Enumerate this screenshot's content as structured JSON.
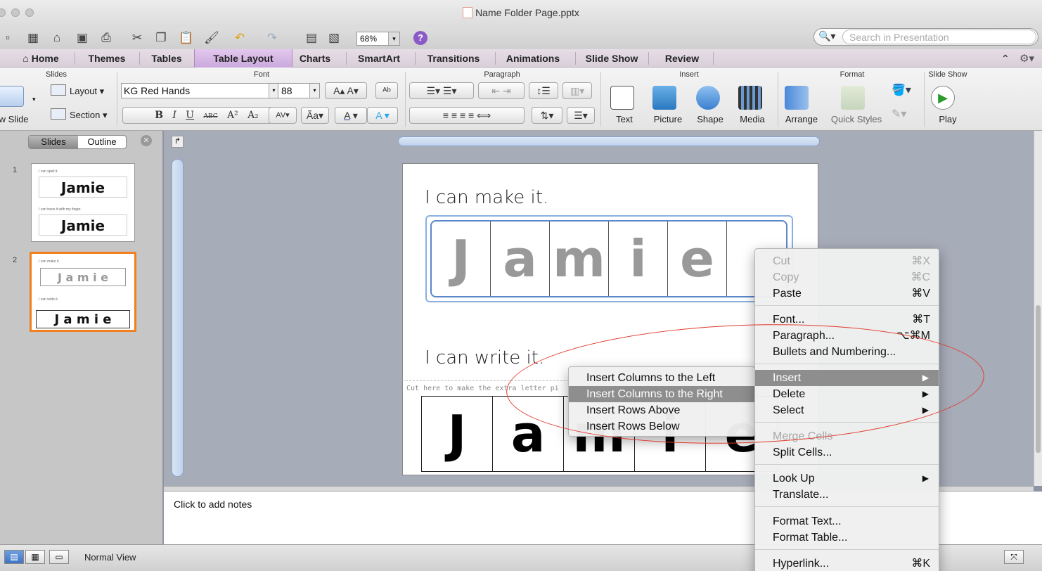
{
  "window": {
    "title": "Name Folder Page.pptx"
  },
  "toolbar": {
    "zoom": "68%",
    "search_placeholder": "Search in Presentation"
  },
  "tabs": [
    "Home",
    "Themes",
    "Tables",
    "Table Layout",
    "Charts",
    "SmartArt",
    "Transitions",
    "Animations",
    "Slide Show",
    "Review"
  ],
  "ribbon": {
    "groups": {
      "slides": "Slides",
      "font": "Font",
      "paragraph": "Paragraph",
      "insert": "Insert",
      "format": "Format",
      "slideshow": "Slide Show"
    },
    "new_slide": "New Slide",
    "layout": "Layout",
    "section": "Section",
    "font_name": "KG Red Hands",
    "font_size": "88",
    "insert_labels": {
      "text": "Text",
      "picture": "Picture",
      "shape": "Shape",
      "media": "Media"
    },
    "format_labels": {
      "arrange": "Arrange",
      "quick_styles": "Quick Styles"
    },
    "play": "Play"
  },
  "leftpane": {
    "seg_slides": "Slides",
    "seg_outline": "Outline",
    "thumbs": [
      {
        "num": "1",
        "line1": "I can spell it.",
        "name1": "Jamie",
        "line2": "I can trace it with my finger.",
        "name2": "Jamie"
      },
      {
        "num": "2",
        "line1": "I can make it.",
        "letters": "J a m i e",
        "line2": "I can write it.",
        "letters2": "J a m i e"
      }
    ]
  },
  "slide": {
    "heading1": "I can make it.",
    "letters": [
      "J",
      "a",
      "m",
      "i",
      "e",
      ""
    ],
    "heading2": "I can write it.",
    "cut_text": "Cut here to make the extra letter pi",
    "letters2": [
      "J",
      "a",
      "m",
      "i",
      "e"
    ]
  },
  "notes": {
    "placeholder": "Click to add notes"
  },
  "status": {
    "view": "Normal View"
  },
  "context_menu": {
    "items": [
      {
        "label": "Cut",
        "shortcut": "⌘X",
        "disabled": true
      },
      {
        "label": "Copy",
        "shortcut": "⌘C",
        "disabled": true
      },
      {
        "label": "Paste",
        "shortcut": "⌘V"
      },
      {
        "label": "Font...",
        "shortcut": "⌘T"
      },
      {
        "label": "Paragraph...",
        "shortcut": "⌥⌘M"
      },
      {
        "label": "Bullets and Numbering..."
      },
      {
        "label": "Insert",
        "submenu": true,
        "highlighted": true
      },
      {
        "label": "Delete",
        "submenu": true
      },
      {
        "label": "Select",
        "submenu": true
      },
      {
        "label": "Merge Cells",
        "disabled": true
      },
      {
        "label": "Split Cells..."
      },
      {
        "label": "Look Up",
        "submenu": true
      },
      {
        "label": "Translate..."
      },
      {
        "label": "Format Text..."
      },
      {
        "label": "Format Table..."
      },
      {
        "label": "Hyperlink...",
        "shortcut": "⌘K"
      }
    ]
  },
  "submenu": {
    "items": [
      "Insert Columns to the Left",
      "Insert Columns to the Right",
      "Insert Rows Above",
      "Insert Rows Below"
    ],
    "highlighted": "Insert Columns to the Right"
  },
  "colors": {
    "accent_tab": "#caa8dc",
    "selection": "#f08020",
    "annotation": "#e03a2a"
  }
}
